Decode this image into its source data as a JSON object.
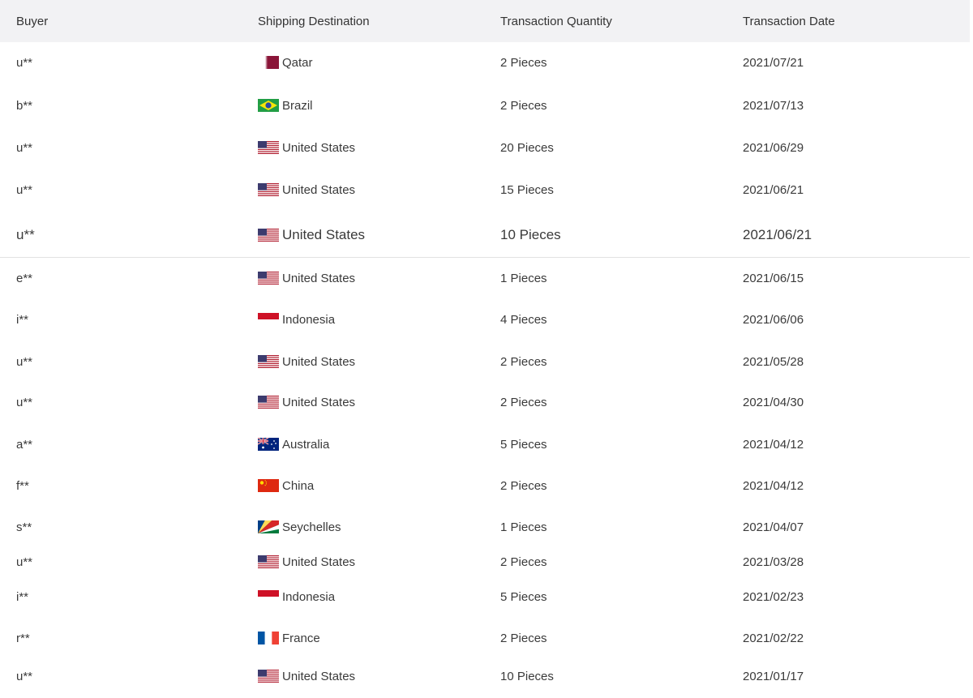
{
  "headers": {
    "buyer": "Buyer",
    "destination": "Shipping Destination",
    "quantity": "Transaction Quantity",
    "date": "Transaction Date"
  },
  "rows": [
    {
      "buyer": "u**",
      "country": "Qatar",
      "flag": "qatar-flag-icon",
      "qty": "2 Pieces",
      "date": "2021/07/21"
    },
    {
      "buyer": "b**",
      "country": "Brazil",
      "flag": "brazil-flag-icon",
      "qty": "2 Pieces",
      "date": "2021/07/13"
    },
    {
      "buyer": "u**",
      "country": "United States",
      "flag": "us-flag-icon",
      "qty": "20 Pieces",
      "date": "2021/06/29"
    },
    {
      "buyer": "u**",
      "country": "United States",
      "flag": "us-flag-icon",
      "qty": "15 Pieces",
      "date": "2021/06/21"
    },
    {
      "buyer": "u**",
      "country": "United States",
      "flag": "us-flag-icon",
      "qty": "10 Pieces",
      "date": "2021/06/21"
    },
    {
      "buyer": "e**",
      "country": "United States",
      "flag": "us-flag-icon",
      "qty": "1 Pieces",
      "date": "2021/06/15"
    },
    {
      "buyer": "i**",
      "country": "Indonesia",
      "flag": "indonesia-flag-icon",
      "qty": "4 Pieces",
      "date": "2021/06/06"
    },
    {
      "buyer": "u**",
      "country": "United States",
      "flag": "us-flag-icon",
      "qty": "2 Pieces",
      "date": "2021/05/28"
    },
    {
      "buyer": "u**",
      "country": "United States",
      "flag": "us-flag-icon",
      "qty": "2 Pieces",
      "date": "2021/04/30"
    },
    {
      "buyer": "a**",
      "country": "Australia",
      "flag": "australia-flag-icon",
      "qty": "5 Pieces",
      "date": "2021/04/12"
    },
    {
      "buyer": "f**",
      "country": "China",
      "flag": "china-flag-icon",
      "qty": "2 Pieces",
      "date": "2021/04/12"
    },
    {
      "buyer": "s**",
      "country": "Seychelles",
      "flag": "seychelles-flag-icon",
      "qty": "1 Pieces",
      "date": "2021/04/07"
    },
    {
      "buyer": "u**",
      "country": "United States",
      "flag": "us-flag-icon",
      "qty": "2 Pieces",
      "date": "2021/03/28"
    },
    {
      "buyer": "i**",
      "country": "Indonesia",
      "flag": "indonesia-flag-icon",
      "qty": "5 Pieces",
      "date": "2021/02/23"
    },
    {
      "buyer": "r**",
      "country": "France",
      "flag": "france-flag-icon",
      "qty": "2 Pieces",
      "date": "2021/02/22"
    },
    {
      "buyer": "u**",
      "country": "United States",
      "flag": "us-flag-icon",
      "qty": "10 Pieces",
      "date": "2021/01/17"
    }
  ]
}
